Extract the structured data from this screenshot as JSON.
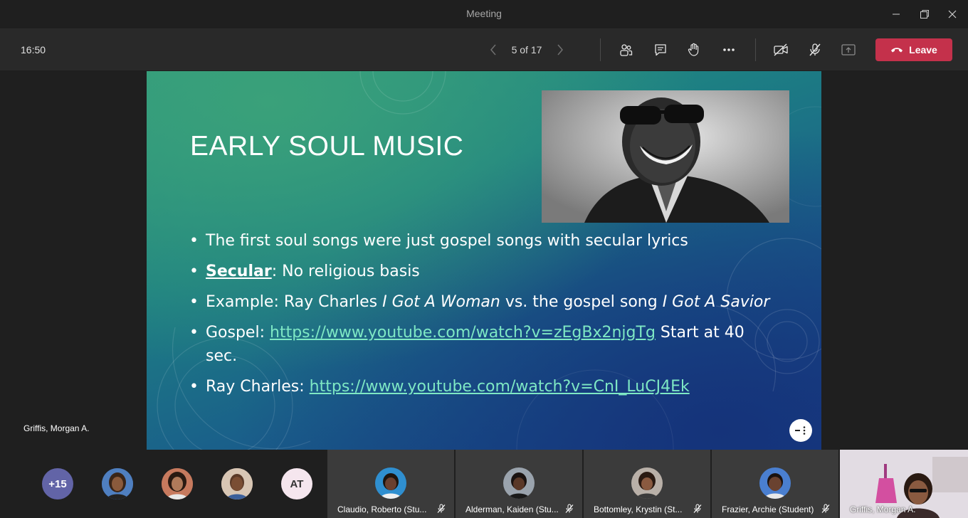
{
  "window": {
    "title": "Meeting"
  },
  "toolbar": {
    "clock": "16:50",
    "slide_counter": "5 of 17",
    "leave_label": "Leave"
  },
  "slide": {
    "title": "EARLY SOUL MUSIC",
    "bullets": {
      "b1": "The first soul songs were just gospel songs with secular lyrics",
      "b2_term": "Secular",
      "b2_rest": ": No religious basis",
      "b3_pre": "Example: Ray Charles ",
      "b3_song1": "I Got A Woman",
      "b3_mid": " vs. the gospel song ",
      "b3_song2": "I Got A Savior",
      "b4_pre": "Gospel: ",
      "b4_link": "https://www.youtube.com/watch?v=zEgBx2njgTg",
      "b4_post": " Start at 40 sec.",
      "b5_pre": "Ray Charles: ",
      "b5_link": "https://www.youtube.com/watch?v=CnI_LuCJ4Ek"
    }
  },
  "presenter": {
    "name": "Griffis, Morgan A."
  },
  "participants": {
    "overflow": "+15",
    "initials_avatar": "AT",
    "tiles": [
      {
        "name": "Claudio, Roberto (Stu..."
      },
      {
        "name": "Alderman, Kaiden (Stu..."
      },
      {
        "name": "Bottomley, Krystin (St..."
      },
      {
        "name": "Frazier, Archie (Student)"
      }
    ],
    "self_view": {
      "name": "Griffis, Morgan A."
    }
  },
  "colors": {
    "leave": "#c4314b",
    "link": "#7ee8c4",
    "overflow_avatar": "#6264a7",
    "initials_avatar": "#f5e6ee"
  }
}
